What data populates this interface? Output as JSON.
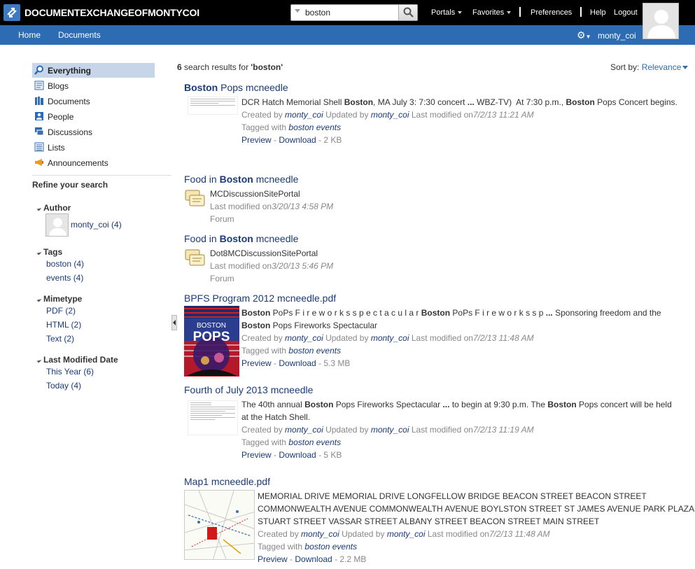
{
  "topbar": {
    "site_title": "DOCUMENTEXCHANGEOFMONTYCOI",
    "search_value": "boston",
    "nav": [
      "Portals",
      "Favorites",
      "Preferences",
      "Help",
      "Logout"
    ]
  },
  "bluebar": {
    "nav": [
      "Home",
      "Documents"
    ],
    "user": "monty_coi"
  },
  "sidebar": {
    "items": [
      {
        "label": "Everything",
        "icon": "search-icon"
      },
      {
        "label": "Blogs",
        "icon": "blog-icon"
      },
      {
        "label": "Documents",
        "icon": "documents-icon"
      },
      {
        "label": "People",
        "icon": "people-icon"
      },
      {
        "label": "Discussions",
        "icon": "discussions-icon"
      },
      {
        "label": "Lists",
        "icon": "lists-icon"
      },
      {
        "label": "Announcements",
        "icon": "megaphone-icon"
      }
    ],
    "refine_label": "Refine your search",
    "facets": {
      "author": {
        "label": "Author",
        "value": "monty_coi (4)"
      },
      "tags": {
        "label": "Tags",
        "values": [
          "boston (4)",
          "events (4)"
        ]
      },
      "mimetype": {
        "label": "Mimetype",
        "values": [
          "PDF (2)",
          "HTML (2)",
          "Text (2)"
        ]
      },
      "modified": {
        "label": "Last Modified Date",
        "values": [
          "This Year (6)",
          "Today (4)"
        ]
      }
    }
  },
  "results_header": {
    "count": "6",
    "text": "search results for",
    "query": "'boston'",
    "sort_label": "Sort by:",
    "sort_value": "Relevance"
  },
  "labels": {
    "created_by": "Created by",
    "updated_by": "Updated by",
    "last_modified": "Last modified on",
    "tagged_with": "Tagged with",
    "preview": "Preview",
    "download": "Download",
    "dash": " - "
  },
  "results": [
    {
      "title_bold": "Boston",
      "title_rest": " Pops mcneedle",
      "snippet": "DCR Hatch Memorial Shell Boston, MA July 3: 7:30 concert ... WBZ-TV)  At 7:30 p.m., Boston Pops Concert begins.",
      "creator": "monty_coi",
      "updater": "monty_coi",
      "modified": "7/2/13 11:21 AM",
      "tags": "boston events",
      "size": "2 KB"
    },
    {
      "title_pre": "Food in ",
      "title_bold": "Boston",
      "title_rest": " mcneedle",
      "site": "MCDiscussionSitePortal",
      "modified": "3/20/13 4:58 PM",
      "type": "Forum"
    },
    {
      "title_pre": "Food in ",
      "title_bold": "Boston",
      "title_rest": " mcneedle",
      "site": "Dot8MCDiscussionSitePortal",
      "modified": "3/20/13 5:46 PM",
      "type": "Forum"
    },
    {
      "title": "BPFS Program 2012 mcneedle.pdf",
      "snippet_line1": "Boston PoPs F i r e w o r k s s p e c t a c u l a r Boston PoPs F i r e w o r k s s p ... Sponsoring freedom and the",
      "snippet_line2": "Boston Pops Fireworks Spectacular",
      "poster_line1": "BOSTON",
      "poster_line2": "POPS",
      "creator": "monty_coi",
      "updater": "monty_coi",
      "modified": "7/2/13 11:48 AM",
      "tags": "boston events",
      "size": "5.3 MB"
    },
    {
      "title": "Fourth of July 2013 mcneedle",
      "snippet_line1": "The 40th annual Boston Pops Fireworks Spectacular ... to begin at 9:30 p.m. The Boston Pops concert will be held",
      "snippet_line2": "at the Hatch Shell.",
      "creator": "monty_coi",
      "updater": "monty_coi",
      "modified": "7/2/13 11:19 AM",
      "tags": "boston events",
      "size": "5 KB"
    },
    {
      "title": "Map1 mcneedle.pdf",
      "snippet_line1": "MEMORIAL DRIVE MEMORIAL DRIVE LONGFELLOW BRIDGE BEACON STREET BEACON STREET",
      "snippet_line2": "COMMONWEALTH AVENUE COMMONWEALTH AVENUE BOYLSTON STREET ST JAMES AVENUE PARK PLAZA",
      "snippet_line3": "STUART STREET VASSAR STREET ALBANY STREET BEACON STREET MAIN STREET",
      "creator": "monty_coi",
      "updater": "monty_coi",
      "modified": "7/2/13 11:48 AM",
      "tags": "boston events",
      "size": "2.2 MB"
    }
  ]
}
